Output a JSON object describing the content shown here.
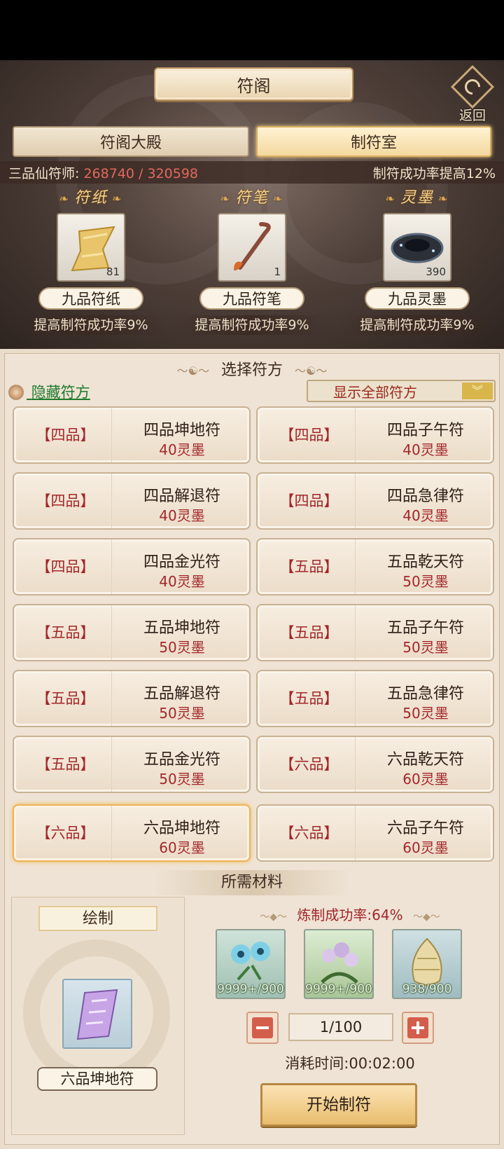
{
  "header": {
    "title": "符阁",
    "back_label": "返回"
  },
  "tabs": [
    {
      "label": "符阁大殿",
      "active": false
    },
    {
      "label": "制符室",
      "active": true
    }
  ],
  "status": {
    "rank": "三品仙符师:",
    "exp": "268740 / 320598",
    "bonus": "制符成功率提高12%"
  },
  "materials": [
    {
      "header": "符纸",
      "icon": "paper-icon",
      "count": "81",
      "name": "九品符纸",
      "bonus": "提高制符成功率9%"
    },
    {
      "header": "符笔",
      "icon": "brush-icon",
      "count": "1",
      "name": "九品符笔",
      "bonus": "提高制符成功率9%"
    },
    {
      "header": "灵墨",
      "icon": "inkstone-icon",
      "count": "390",
      "name": "九品灵墨",
      "bonus": "提高制符成功率9%"
    }
  ],
  "select": {
    "title": "选择符方",
    "hide_link": "隐藏符方",
    "filter": "显示全部符方"
  },
  "recipes": [
    {
      "grade": "【四品】",
      "name": "四品坤地符",
      "cost": "40灵墨"
    },
    {
      "grade": "【四品】",
      "name": "四品子午符",
      "cost": "40灵墨"
    },
    {
      "grade": "【四品】",
      "name": "四品解退符",
      "cost": "40灵墨"
    },
    {
      "grade": "【四品】",
      "name": "四品急律符",
      "cost": "40灵墨"
    },
    {
      "grade": "【四品】",
      "name": "四品金光符",
      "cost": "40灵墨"
    },
    {
      "grade": "【五品】",
      "name": "五品乾天符",
      "cost": "50灵墨"
    },
    {
      "grade": "【五品】",
      "name": "五品坤地符",
      "cost": "50灵墨"
    },
    {
      "grade": "【五品】",
      "name": "五品子午符",
      "cost": "50灵墨"
    },
    {
      "grade": "【五品】",
      "name": "五品解退符",
      "cost": "50灵墨"
    },
    {
      "grade": "【五品】",
      "name": "五品急律符",
      "cost": "50灵墨"
    },
    {
      "grade": "【五品】",
      "name": "五品金光符",
      "cost": "50灵墨"
    },
    {
      "grade": "【六品】",
      "name": "六品乾天符",
      "cost": "60灵墨"
    },
    {
      "grade": "【六品】",
      "name": "六品坤地符",
      "cost": "60灵墨",
      "selected": true
    },
    {
      "grade": "【六品】",
      "name": "六品子午符",
      "cost": "60灵墨"
    }
  ],
  "required": {
    "title": "所需材料",
    "draw_label": "绘制",
    "draw_item": "六品坤地符",
    "success_rate": "炼制成功率:64%",
    "ingredients": [
      {
        "icon": "blue-flower-icon",
        "qty": "9999+/900"
      },
      {
        "icon": "lilac-herb-icon",
        "qty": "9999+/900"
      },
      {
        "icon": "golden-cone-icon",
        "qty": "938/900"
      }
    ],
    "quantity": "1/100",
    "time": "消耗时间:00:02:00",
    "start_label": "开始制符"
  },
  "colors": {
    "accent_red": "#a3262a",
    "link_green": "#1f7a2e",
    "gold": "#e9bd6f"
  }
}
